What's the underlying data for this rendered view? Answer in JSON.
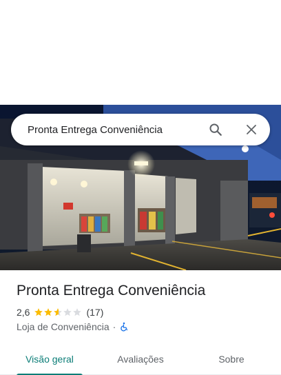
{
  "search": {
    "query": "Pronta Entrega Conveniência",
    "search_icon": "search-icon",
    "close_icon": "close-icon"
  },
  "place": {
    "name": "Pronta Entrega Conveniência",
    "rating": "2,6",
    "rating_value": 2.6,
    "stars_max": 5,
    "review_count": "(17)",
    "category": "Loja de Conveniência",
    "separator": "·",
    "accessibility_icon": "wheelchair-icon"
  },
  "tabs": [
    {
      "label": "Visão geral",
      "active": true
    },
    {
      "label": "Avaliações",
      "active": false
    },
    {
      "label": "Sobre",
      "active": false
    }
  ],
  "colors": {
    "accent": "#0b7d77",
    "star": "#fbbc04",
    "star_empty": "#dadce0",
    "accessibility": "#1a73e8"
  }
}
